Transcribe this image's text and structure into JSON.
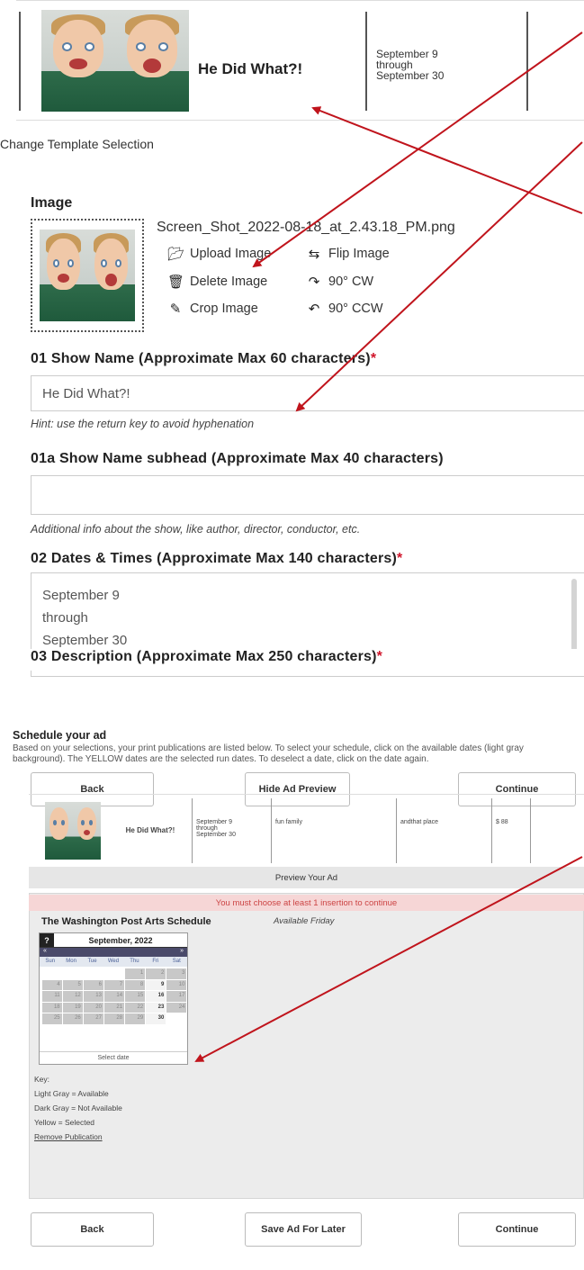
{
  "ad_template": {
    "title": "He Did What?!",
    "dates": "September 9\nthrough\nSeptember 30"
  },
  "change_template_link": "Change Template Selection",
  "image_section": {
    "heading": "Image",
    "filename": "Screen_Shot_2022-08-18_at_2.43.18_PM.png",
    "actions": {
      "upload": "Upload Image",
      "flip": "Flip Image",
      "delete": "Delete Image",
      "rotate_cw": "90° CW",
      "crop": "Crop Image",
      "rotate_ccw": "90° CCW"
    }
  },
  "fields": {
    "show_name": {
      "label": "01 Show Name (Approximate Max 60 characters)",
      "required_mark": "*",
      "value": "He Did What?!",
      "hint": "Hint: use the return key to avoid hyphenation"
    },
    "subhead": {
      "label": "01a Show Name subhead (Approximate Max 40 characters)",
      "value": "",
      "hint": "Additional info about the show, like author, director, conductor, etc."
    },
    "dates_times": {
      "label": "02 Dates & Times (Approximate Max 140 characters)",
      "required_mark": "*",
      "lines": [
        "September 9",
        "through",
        "September 30"
      ]
    },
    "description": {
      "label": "03 Description (Approximate Max 250 characters)",
      "required_mark": "*"
    }
  },
  "schedule": {
    "title": "Schedule your ad",
    "description": "Based on your selections, your print publications are listed below. To select your schedule, click on the available dates (light gray background). The YELLOW dates are the selected run dates. To deselect a date, click on the date again.",
    "buttons_top": {
      "back": "Back",
      "hide_preview": "Hide Ad Preview",
      "continue": "Continue"
    },
    "preview_strip": {
      "title": "He Did What?!",
      "dates": "September 9\nthrough\nSeptember 30",
      "col3": "fun family",
      "col4": "andthat place",
      "col5": "$ 88"
    },
    "preview_label": "Preview Your Ad",
    "warning": "You must choose at least 1 insertion to continue",
    "publication": "The Washington Post Arts Schedule",
    "availability": "Available Friday",
    "calendar": {
      "help": "?",
      "month": "September, 2022",
      "nav_prev": "«",
      "nav_next": "»",
      "weekdays": [
        "Sun",
        "Mon",
        "Tue",
        "Wed",
        "Thu",
        "Fri",
        "Sat"
      ],
      "weeks": [
        [
          "",
          "",
          "",
          "",
          "1",
          "2",
          "3"
        ],
        [
          "4",
          "5",
          "6",
          "7",
          "8",
          "9",
          "10"
        ],
        [
          "11",
          "12",
          "13",
          "14",
          "15",
          "16",
          "17"
        ],
        [
          "18",
          "19",
          "20",
          "21",
          "22",
          "23",
          "24"
        ],
        [
          "25",
          "26",
          "27",
          "28",
          "29",
          "30",
          ""
        ]
      ],
      "available_days": [
        "9",
        "16",
        "23",
        "30"
      ],
      "footer": "Select date"
    },
    "key": {
      "heading": "Key:",
      "light_gray": "Light Gray = Available",
      "dark_gray": "Dark Gray = Not Available",
      "yellow": "Yellow = Selected",
      "remove": "Remove Publication"
    },
    "buttons_bottom": {
      "back": "Back",
      "save": "Save Ad For Later",
      "continue": "Continue"
    }
  },
  "annotation_color": "#c0141c"
}
